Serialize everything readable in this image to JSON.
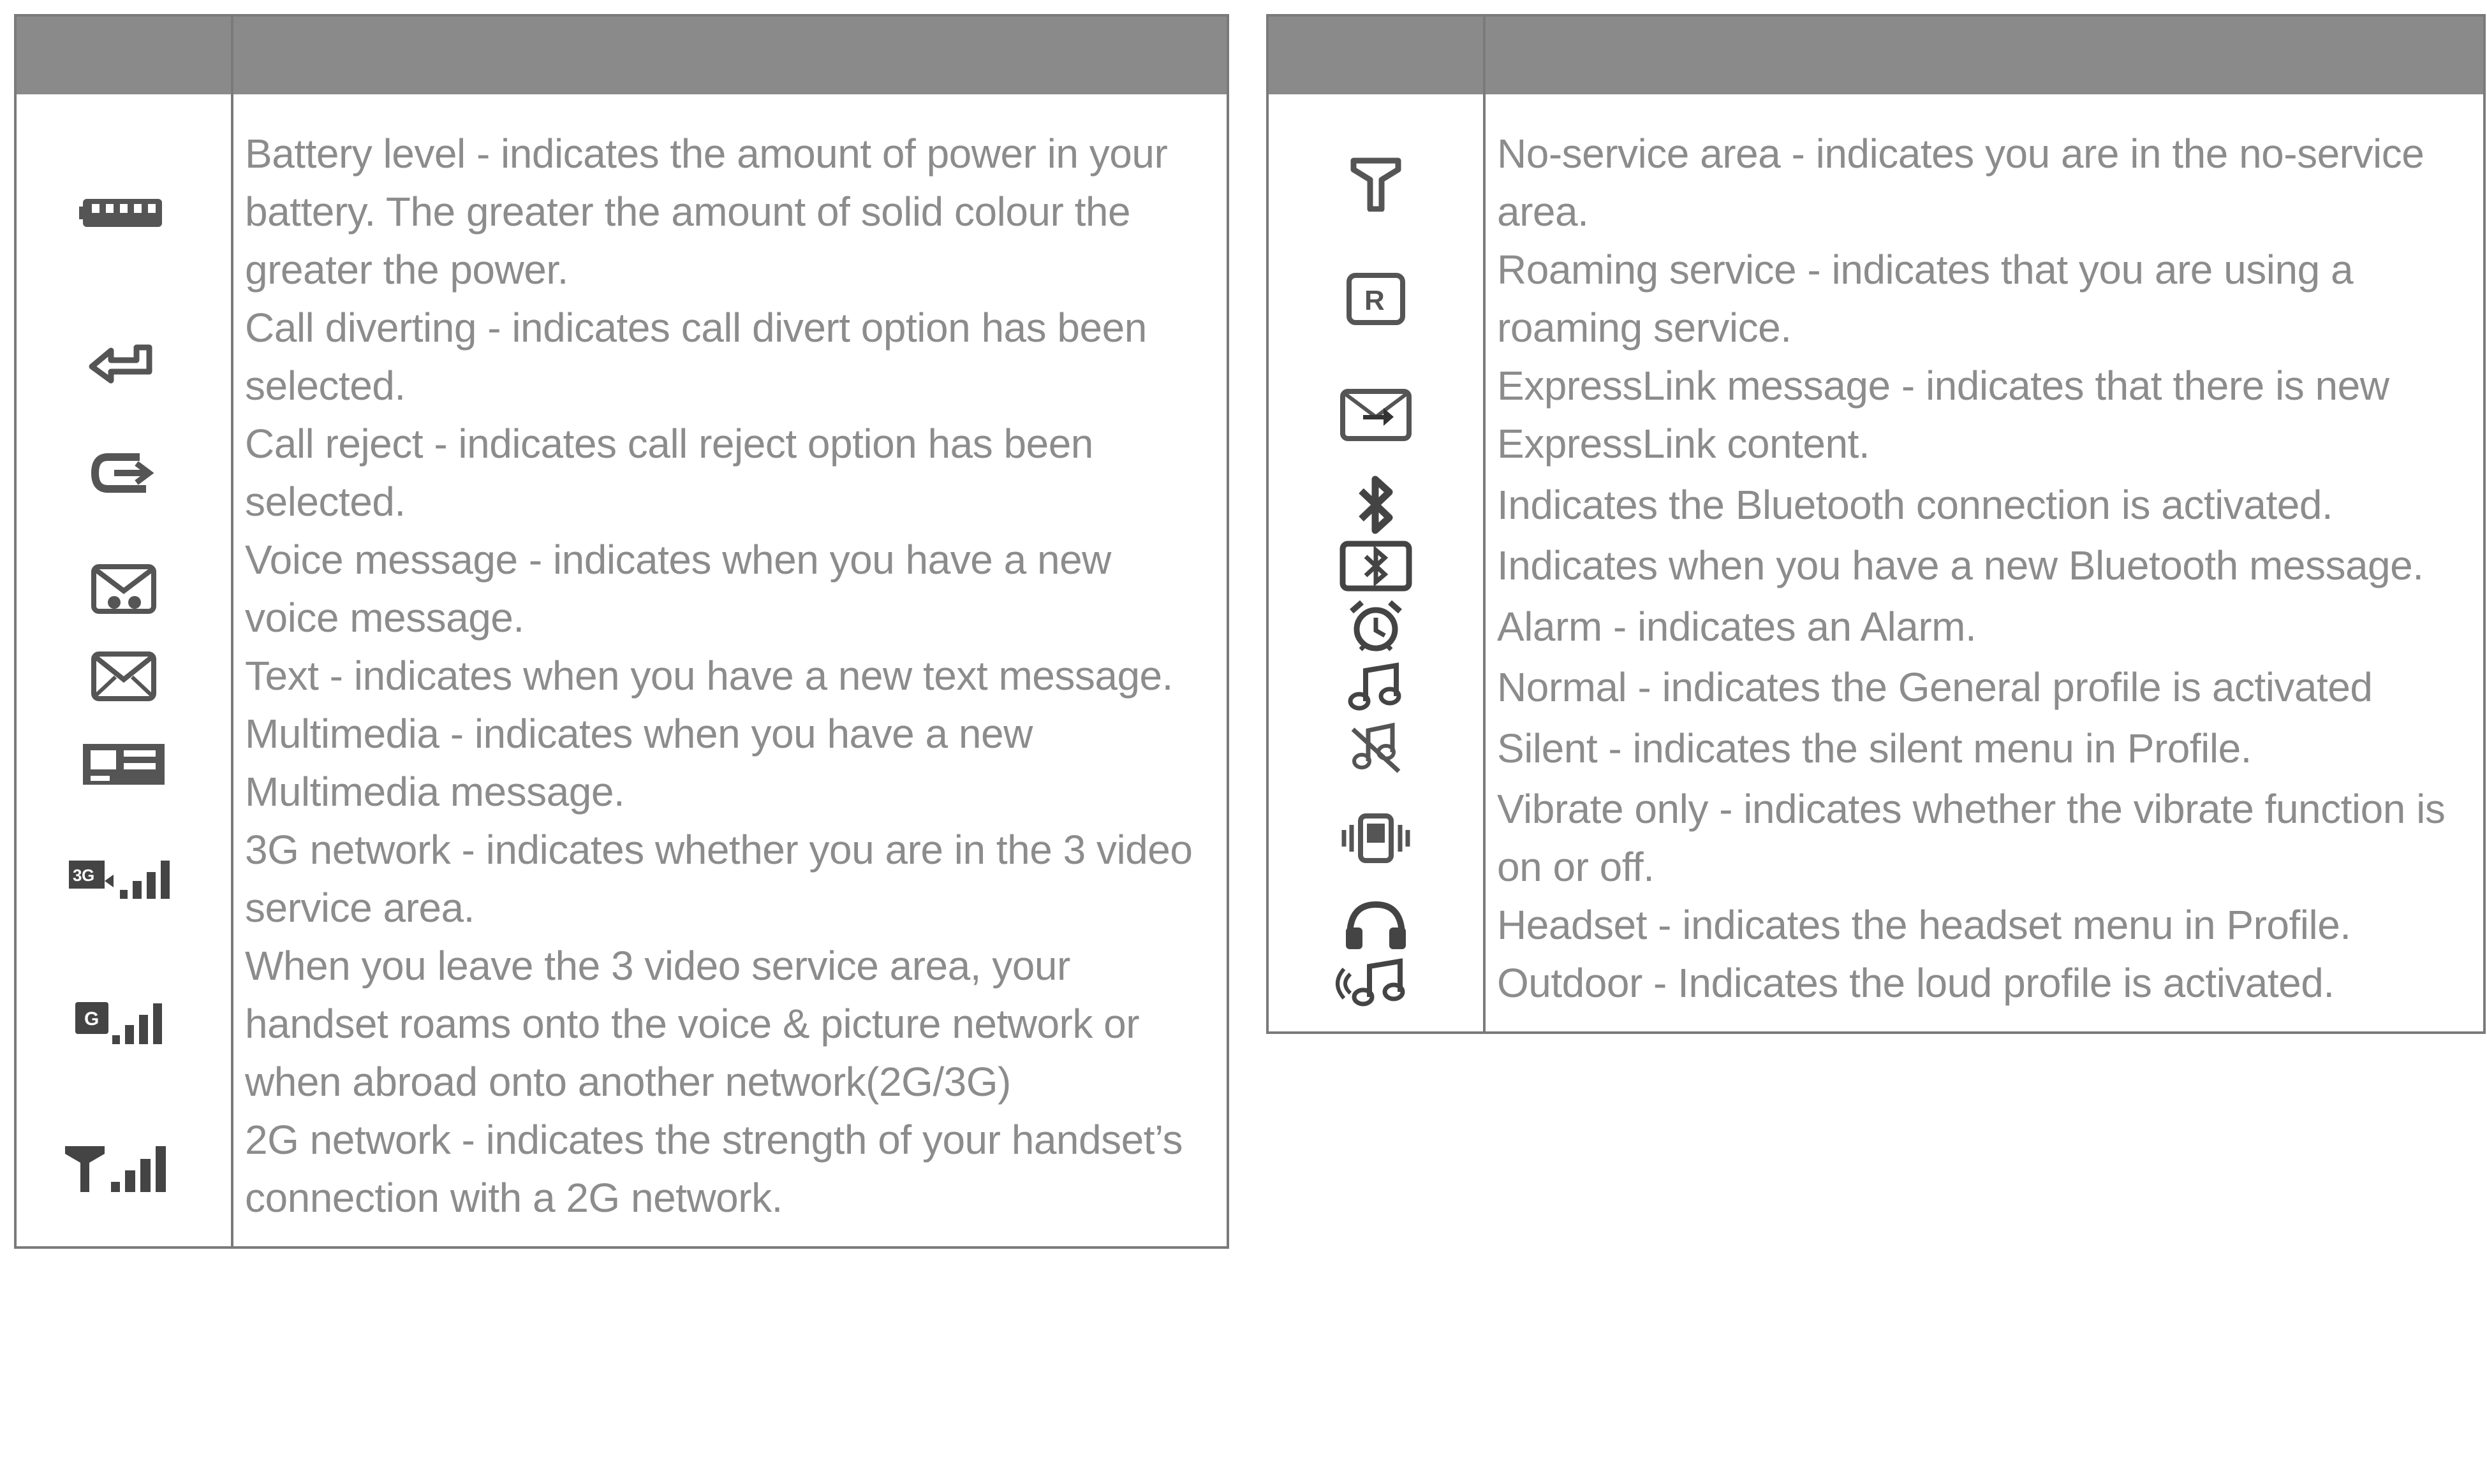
{
  "left_table": {
    "rows": [
      {
        "icon": "battery-icon",
        "text": "Battery level - indicates the amount of power in your battery. The greater the amount of solid colour the greater the power."
      },
      {
        "icon": "call-divert-icon",
        "text": "Call diverting - indicates call divert option has been selected."
      },
      {
        "icon": "call-reject-icon",
        "text": "Call reject - indicates call reject option has been selected."
      },
      {
        "icon": "voice-message-icon",
        "text": "Voice message - indicates when you have a new voice message."
      },
      {
        "icon": "envelope-icon",
        "text": "Text - indicates when you have a new text message."
      },
      {
        "icon": "multimedia-message-icon",
        "text": "Multimedia - indicates when you have a new Multimedia message."
      },
      {
        "icon": "3g-signal-icon",
        "text": "3G network - indicates whether you are in the 3 video service area."
      },
      {
        "icon": "g-signal-icon",
        "text": "When you leave the 3 video service area, your handset roams onto the voice & picture network or when abroad onto another network(2G/3G)"
      },
      {
        "icon": "2g-signal-icon",
        "text": "2G network - indicates the strength of your handset’s connection with a 2G network."
      }
    ]
  },
  "right_table": {
    "rows": [
      {
        "icon": "no-service-antenna-icon",
        "text": "No-service area - indicates you are in the no-service area."
      },
      {
        "icon": "roaming-icon",
        "text": "Roaming service - indicates that you are using a roaming service."
      },
      {
        "icon": "expresslink-icon",
        "text": "ExpressLink message - indicates that there is new ExpressLink content."
      },
      {
        "icon": "bluetooth-icon",
        "text": "Indicates the Bluetooth connection is activated."
      },
      {
        "icon": "bluetooth-message-icon",
        "text": "Indicates when you have a new Bluetooth message."
      },
      {
        "icon": "alarm-clock-icon",
        "text": "Alarm - indicates an Alarm."
      },
      {
        "icon": "music-note-icon",
        "text": "Normal - indicates the General profile is activated"
      },
      {
        "icon": "silent-icon",
        "text": "Silent - indicates the silent menu in Profile."
      },
      {
        "icon": "vibrate-icon",
        "text": "Vibrate only - indicates whether the vibrate function is on or off."
      },
      {
        "icon": "headset-icon",
        "text": "Headset - indicates the headset menu in Profile."
      },
      {
        "icon": "outdoor-icon",
        "text": "Outdoor - Indicates the loud profile is activated."
      }
    ]
  }
}
